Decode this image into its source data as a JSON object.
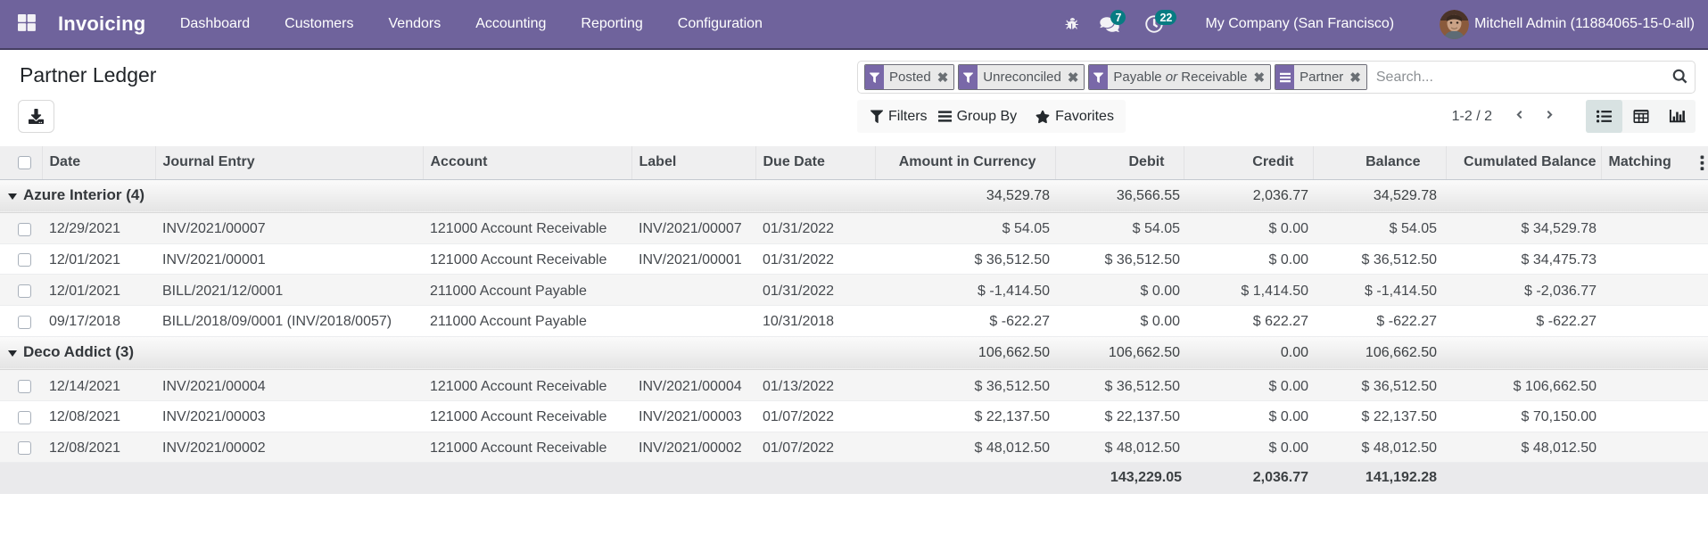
{
  "nav": {
    "app_name": "Invoicing",
    "menu": [
      "Dashboard",
      "Customers",
      "Vendors",
      "Accounting",
      "Reporting",
      "Configuration"
    ],
    "messages_badge": "7",
    "activities_badge": "22",
    "company": "My Company (San Francisco)",
    "user": "Mitchell Admin (11884065-15-0-all)"
  },
  "control_panel": {
    "title": "Partner Ledger",
    "search": {
      "facets": [
        {
          "icon": "filter",
          "parts": [
            [
              "Posted",
              false
            ]
          ]
        },
        {
          "icon": "filter",
          "parts": [
            [
              "Unreconciled",
              false
            ]
          ]
        },
        {
          "icon": "filter",
          "parts": [
            [
              "Payable ",
              false
            ],
            [
              "or",
              true
            ],
            [
              " Receivable",
              false
            ]
          ]
        },
        {
          "icon": "group",
          "parts": [
            [
              "Partner",
              false
            ]
          ]
        }
      ],
      "placeholder": "Search..."
    },
    "buttons": {
      "filters": "Filters",
      "group_by": "Group By",
      "favorites": "Favorites"
    },
    "pager": {
      "range": "1-2",
      "separator": " / ",
      "total": "2"
    }
  },
  "table": {
    "columns": [
      "Date",
      "Journal Entry",
      "Account",
      "Label",
      "Due Date",
      "Amount in Currency",
      "Debit",
      "Credit",
      "Balance",
      "Cumulated Balance",
      "Matching"
    ],
    "groups": [
      {
        "name": "Azure Interior (4)",
        "aggregates": {
          "amount_currency": "34,529.78",
          "debit": "36,566.55",
          "credit": "2,036.77",
          "balance": "34,529.78"
        },
        "rows": [
          [
            "12/29/2021",
            "INV/2021/00007",
            "121000 Account Receivable",
            "INV/2021/00007",
            "01/31/2022",
            "$ 54.05",
            "$ 54.05",
            "$ 0.00",
            "$ 54.05",
            "$ 34,529.78"
          ],
          [
            "12/01/2021",
            "INV/2021/00001",
            "121000 Account Receivable",
            "INV/2021/00001",
            "01/31/2022",
            "$ 36,512.50",
            "$ 36,512.50",
            "$ 0.00",
            "$ 36,512.50",
            "$ 34,475.73"
          ],
          [
            "12/01/2021",
            "BILL/2021/12/0001",
            "211000 Account Payable",
            "",
            "01/31/2022",
            "$ -1,414.50",
            "$ 0.00",
            "$ 1,414.50",
            "$ -1,414.50",
            "$ -2,036.77"
          ],
          [
            "09/17/2018",
            "BILL/2018/09/0001 (INV/2018/0057)",
            "211000 Account Payable",
            "",
            "10/31/2018",
            "$ -622.27",
            "$ 0.00",
            "$ 622.27",
            "$ -622.27",
            "$ -622.27"
          ]
        ]
      },
      {
        "name": "Deco Addict (3)",
        "aggregates": {
          "amount_currency": "106,662.50",
          "debit": "106,662.50",
          "credit": "0.00",
          "balance": "106,662.50"
        },
        "rows": [
          [
            "12/14/2021",
            "INV/2021/00004",
            "121000 Account Receivable",
            "INV/2021/00004",
            "01/13/2022",
            "$ 36,512.50",
            "$ 36,512.50",
            "$ 0.00",
            "$ 36,512.50",
            "$ 106,662.50"
          ],
          [
            "12/08/2021",
            "INV/2021/00003",
            "121000 Account Receivable",
            "INV/2021/00003",
            "01/07/2022",
            "$ 22,137.50",
            "$ 22,137.50",
            "$ 0.00",
            "$ 22,137.50",
            "$ 70,150.00"
          ],
          [
            "12/08/2021",
            "INV/2021/00002",
            "121000 Account Receivable",
            "INV/2021/00002",
            "01/07/2022",
            "$ 48,012.50",
            "$ 48,012.50",
            "$ 0.00",
            "$ 48,012.50",
            "$ 48,012.50"
          ]
        ]
      }
    ],
    "footer": {
      "debit": "143,229.05",
      "credit": "2,036.77",
      "balance": "141,192.28"
    }
  },
  "colors": {
    "navbar": "#6f639c",
    "badge": "#077c82",
    "facet_icon_bg": "#7968a8",
    "active_view_bg": "#d8e2e2"
  }
}
